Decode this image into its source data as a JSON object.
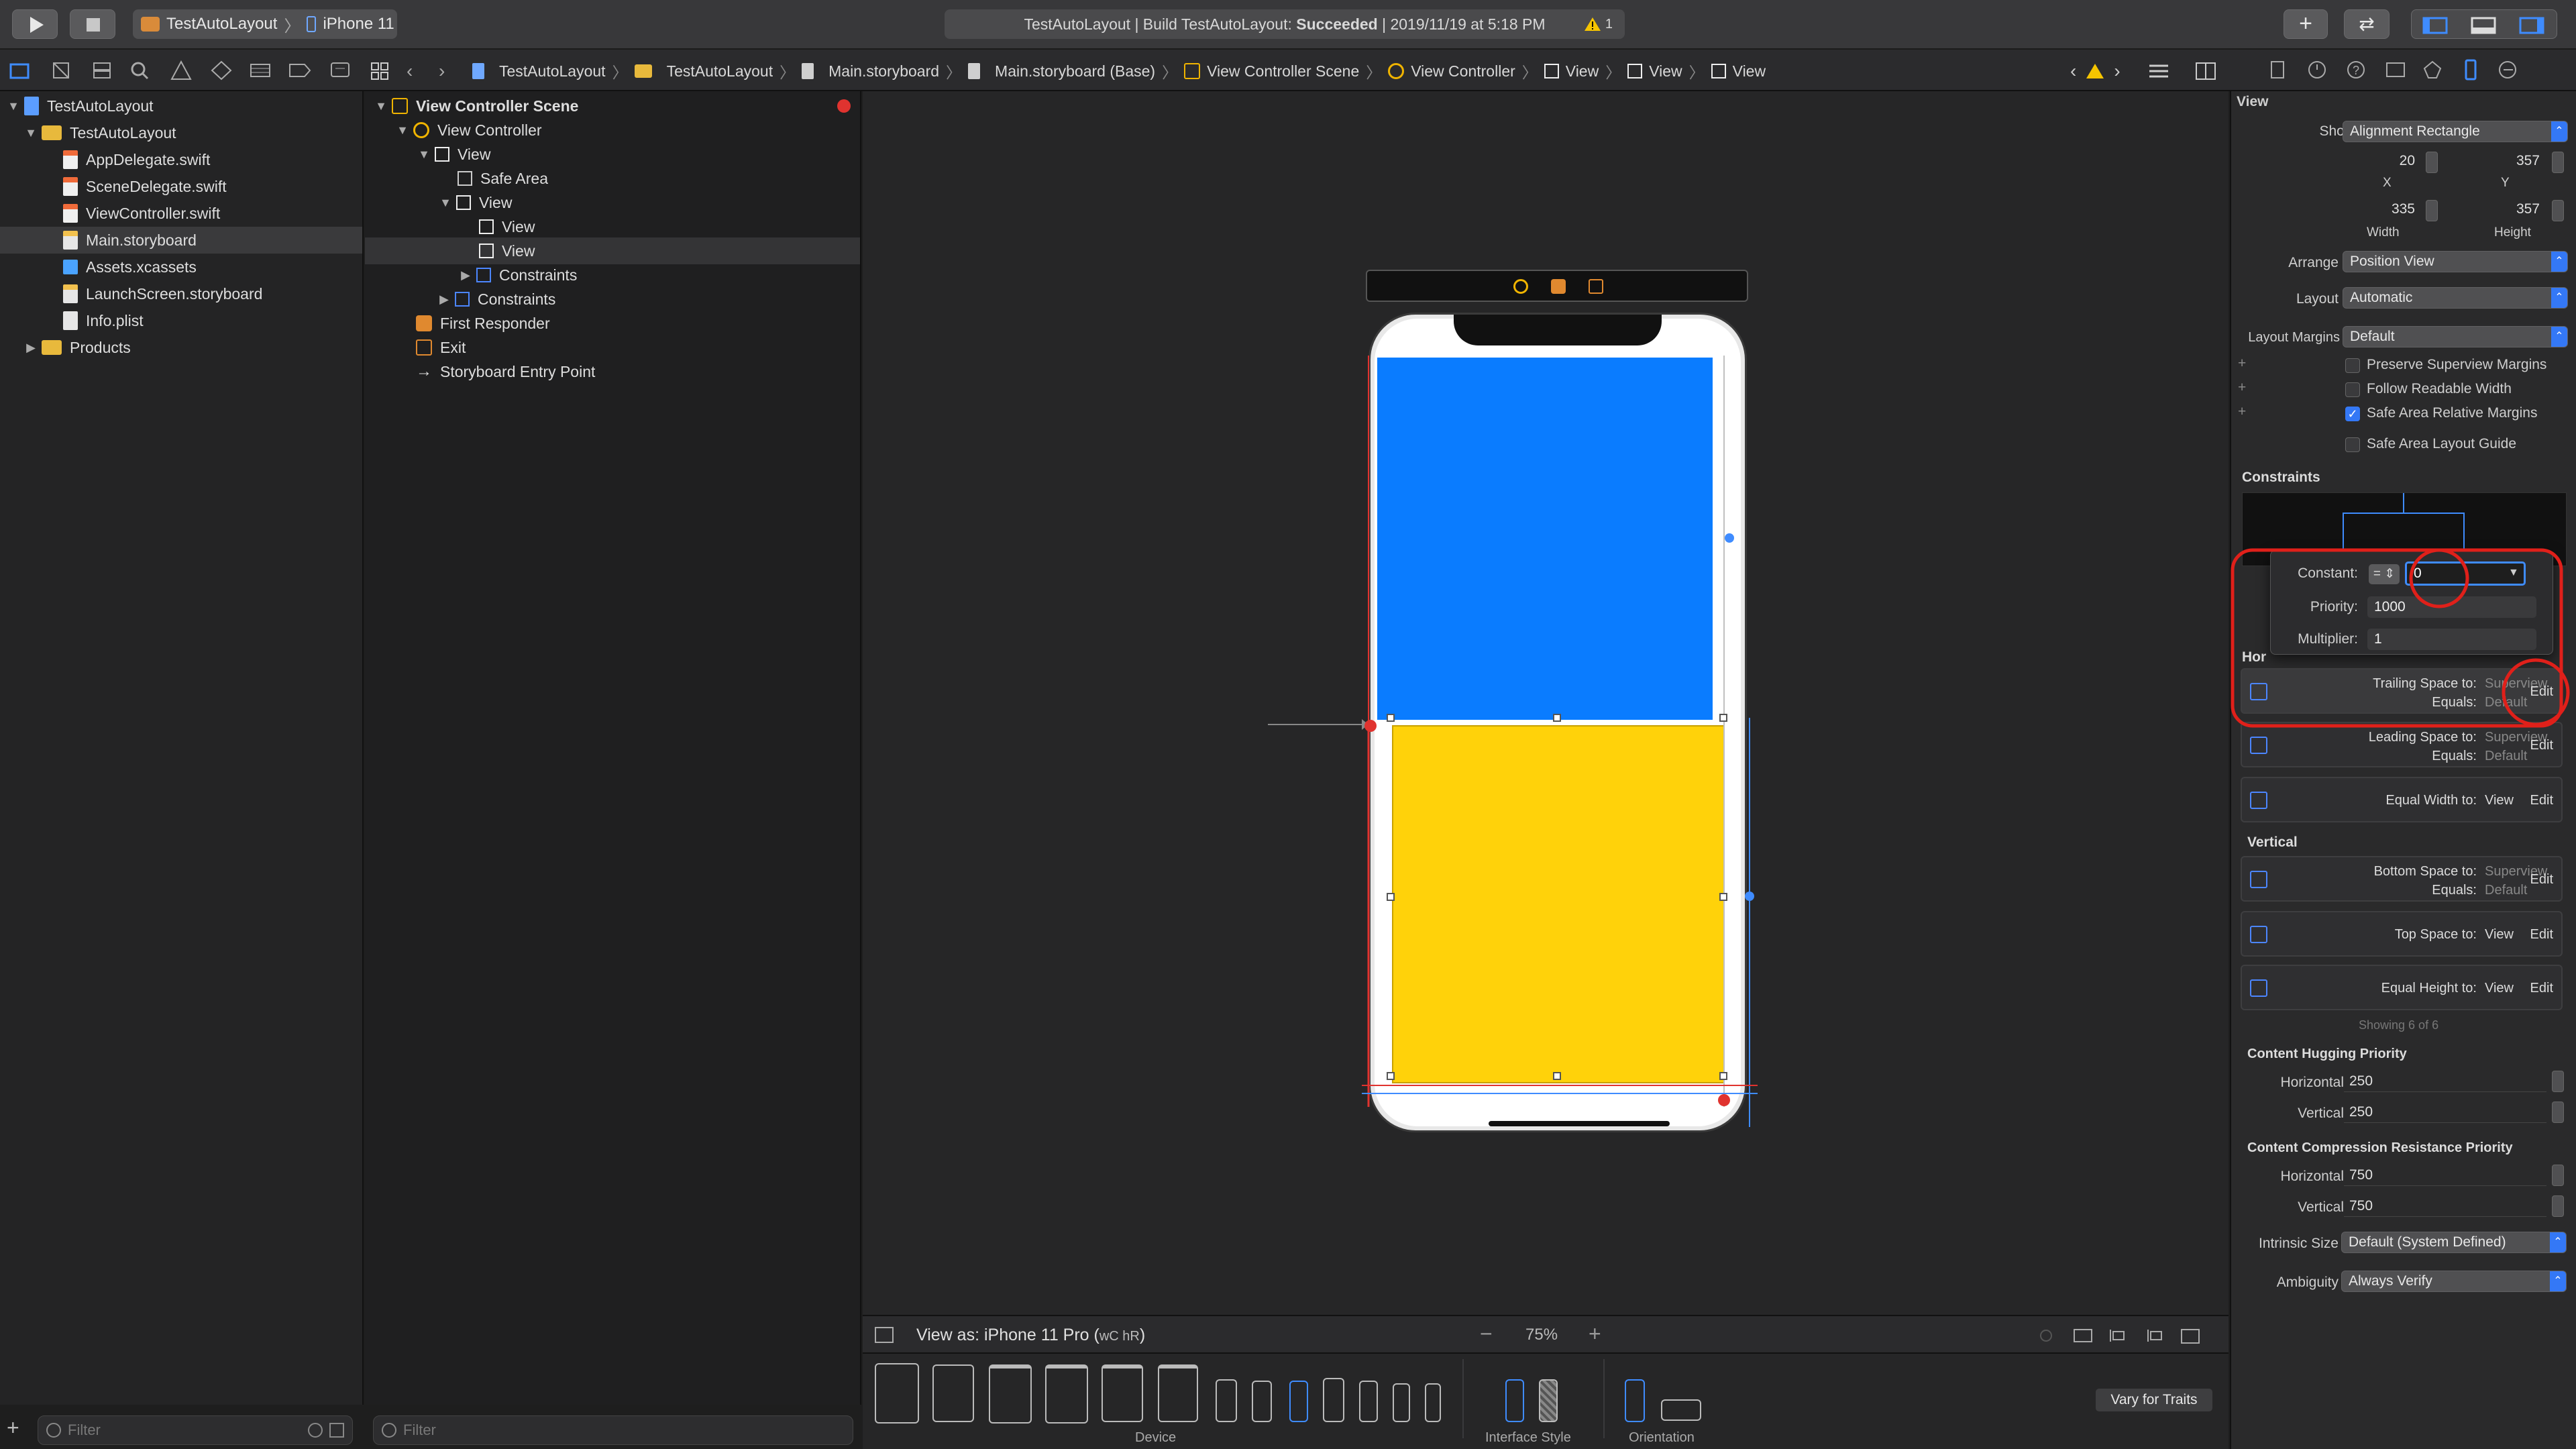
{
  "toolbar": {
    "scheme_project": "TestAutoLayout",
    "scheme_device": "iPhone 11",
    "status_prefix": "TestAutoLayout | Build TestAutoLayout:",
    "status_result": "Succeeded",
    "status_time": "| 2019/11/19 at 5:18 PM",
    "warning_count": "1"
  },
  "jumpbar": {
    "items": [
      "TestAutoLayout",
      "TestAutoLayout",
      "Main.storyboard",
      "Main.storyboard (Base)",
      "View Controller Scene",
      "View Controller",
      "View",
      "View",
      "View"
    ]
  },
  "navigator": {
    "items": [
      {
        "label": "TestAutoLayout",
        "kind": "project"
      },
      {
        "label": "TestAutoLayout",
        "kind": "folder"
      },
      {
        "label": "AppDelegate.swift",
        "kind": "swift"
      },
      {
        "label": "SceneDelegate.swift",
        "kind": "swift"
      },
      {
        "label": "ViewController.swift",
        "kind": "swift"
      },
      {
        "label": "Main.storyboard",
        "kind": "storyboard"
      },
      {
        "label": "Assets.xcassets",
        "kind": "assets"
      },
      {
        "label": "LaunchScreen.storyboard",
        "kind": "storyboard"
      },
      {
        "label": "Info.plist",
        "kind": "plist"
      },
      {
        "label": "Products",
        "kind": "folder"
      }
    ],
    "filter_placeholder": "Filter"
  },
  "outline": {
    "items": [
      {
        "label": "View Controller Scene"
      },
      {
        "label": "View Controller"
      },
      {
        "label": "View"
      },
      {
        "label": "Safe Area"
      },
      {
        "label": "View"
      },
      {
        "label": "View"
      },
      {
        "label": "View"
      },
      {
        "label": "Constraints"
      },
      {
        "label": "Constraints"
      },
      {
        "label": "First Responder"
      },
      {
        "label": "Exit"
      },
      {
        "label": "Storyboard Entry Point"
      }
    ],
    "filter_placeholder": "Filter"
  },
  "canvas": {
    "view_as": "View as: iPhone 11 Pro (",
    "view_as_traits": "wC hR",
    "view_as_close": ")",
    "zoom": "75%",
    "device_label": "Device",
    "interface_style_label": "Interface Style",
    "orientation_label": "Orientation",
    "vary_button": "Vary for Traits",
    "top_color": "#0a7cff",
    "bottom_color": "#ffd20a"
  },
  "inspector": {
    "title": "View",
    "show_label": "Show",
    "show_value": "Alignment Rectangle",
    "x_value": "20",
    "y_value": "357",
    "x_label": "X",
    "y_label": "Y",
    "width_value": "335",
    "height_value": "357",
    "width_label": "Width",
    "height_label": "Height",
    "arrange_label": "Arrange",
    "arrange_value": "Position View",
    "layout_label": "Layout",
    "layout_value": "Automatic",
    "margins_label": "Layout Margins",
    "margins_value": "Default",
    "checks": [
      {
        "label": "Preserve Superview Margins",
        "checked": false
      },
      {
        "label": "Follow Readable Width",
        "checked": false
      },
      {
        "label": "Safe Area Relative Margins",
        "checked": true
      },
      {
        "label": "Safe Area Layout Guide",
        "checked": false
      }
    ],
    "constraints_title": "Constraints",
    "popover": {
      "constant_label": "Constant:",
      "constant_value": "0",
      "priority_label": "Priority:",
      "priority_value": "1000",
      "multiplier_label": "Multiplier:",
      "multiplier_value": "1"
    },
    "horizontal_label": "Hor",
    "horizontal_cards": [
      {
        "l1": "Trailing Space to:",
        "v1": "Superview",
        "l2": "Equals:",
        "v2": "Default",
        "edit": "Edit"
      },
      {
        "l1": "Leading Space to:",
        "v1": "Superview",
        "l2": "Equals:",
        "v2": "Default",
        "edit": "Edit"
      },
      {
        "mid": "Equal Width to:",
        "vm": "View",
        "edit": "Edit"
      }
    ],
    "vertical_label": "Vertical",
    "vertical_cards": [
      {
        "l1": "Bottom Space to:",
        "v1": "Superview",
        "l2": "Equals:",
        "v2": "Default",
        "edit": "Edit"
      },
      {
        "mid": "Top Space to:",
        "vm": "View",
        "edit": "Edit"
      },
      {
        "mid": "Equal Height to:",
        "vm": "View",
        "edit": "Edit"
      }
    ],
    "showing": "Showing 6 of 6",
    "hugging_title": "Content Hugging Priority",
    "hugging_h_label": "Horizontal",
    "hugging_h": "250",
    "hugging_v_label": "Vertical",
    "hugging_v": "250",
    "compression_title": "Content Compression Resistance Priority",
    "compression_h_label": "Horizontal",
    "compression_h": "750",
    "compression_v_label": "Vertical",
    "compression_v": "750",
    "intrinsic_label": "Intrinsic Size",
    "intrinsic_value": "Default (System Defined)",
    "ambiguity_label": "Ambiguity",
    "ambiguity_value": "Always Verify"
  }
}
